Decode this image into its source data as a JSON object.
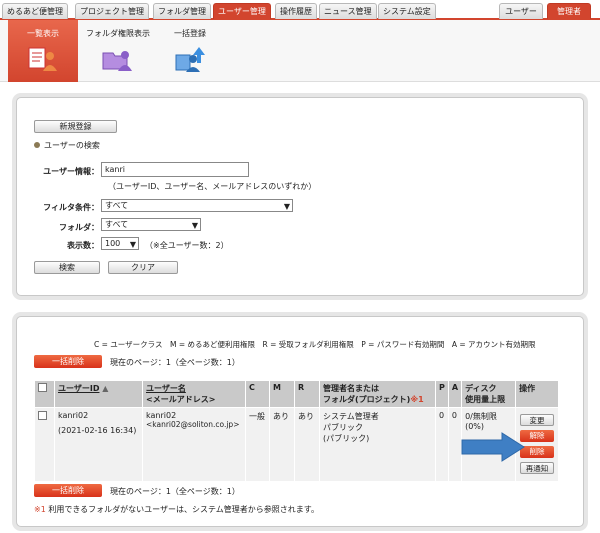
{
  "nav": {
    "tabs": [
      "めるあど便管理",
      "プロジェクト管理",
      "フォルダ管理",
      "ユーザー管理",
      "操作履歴",
      "ニュース管理",
      "システム設定"
    ],
    "right_tabs": [
      "ユーザー",
      "管理者"
    ]
  },
  "subnav": {
    "items": [
      "一覧表示",
      "フォルダ権限表示",
      "一括登録"
    ]
  },
  "search": {
    "new_button": "新規登録",
    "heading": "ユーザーの検索",
    "user_info_label": "ユーザー情報：",
    "user_info_value": "kanri",
    "user_info_hint": "（ユーザーID、ユーザー名、メールアドレスのいずれか）",
    "filter_label": "フィルタ条件：",
    "filter_value": "すべて",
    "folder_label": "フォルダ：",
    "folder_value": "すべて",
    "count_label": "表示数：",
    "count_value": "100",
    "count_note": "（※全ユーザー数：2）",
    "search_button": "検索",
    "clear_button": "クリア"
  },
  "list": {
    "legend": "C = ユーザークラス　M = めるあど便利用権限　R = 受取フォルダ利用権限　P = パスワード有効期間　A = アカウント有効期限",
    "bulk_delete": "一括削除",
    "page_info": "現在のページ：1（全ページ数：1）",
    "columns": {
      "userid": "ユーザーID",
      "sort_mark": "▲",
      "username1": "ユーザー名",
      "username2": "<メールアドレス>",
      "c": "C",
      "m": "M",
      "r": "R",
      "manager1": "管理者名または",
      "manager2": "フォルダ(プロジェクト)",
      "note_mark": "※1",
      "p": "P",
      "a": "A",
      "disk1": "ディスク",
      "disk2": "使用量上限",
      "ops": "操作"
    },
    "row": {
      "userid": "kanri02",
      "date": "(2021-02-16 16:34)",
      "name": "kanri02",
      "email": "<kanri02@soliton.co.jp>",
      "c": "一般",
      "m": "あり",
      "r": "あり",
      "manager1": "システム管理者",
      "manager2": "パブリック",
      "manager3": "(パブリック)",
      "p": "0",
      "a": "0",
      "disk1": "0/無制限",
      "disk2": "(0%)",
      "btn_change": "変更",
      "btn_release": "解除",
      "btn_delete": "削除",
      "btn_renotify": "再通知"
    },
    "footnote_mark": "※1",
    "footnote": "利用できるフォルダがないユーザーは、システム管理者から参照されます。"
  },
  "colors": {
    "accent": "#d2452e",
    "arrow": "#3f7fc4"
  }
}
